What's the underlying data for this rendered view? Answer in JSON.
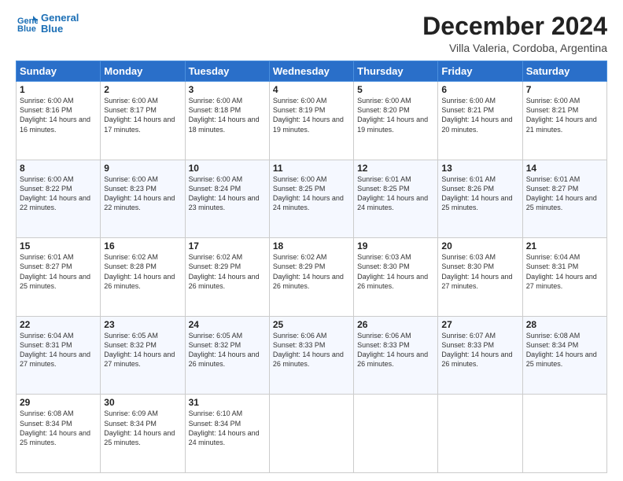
{
  "logo": {
    "text_general": "General",
    "text_blue": "Blue"
  },
  "header": {
    "title": "December 2024",
    "subtitle": "Villa Valeria, Cordoba, Argentina"
  },
  "days_of_week": [
    "Sunday",
    "Monday",
    "Tuesday",
    "Wednesday",
    "Thursday",
    "Friday",
    "Saturday"
  ],
  "weeks": [
    [
      {
        "day": "1",
        "sunrise": "Sunrise: 6:00 AM",
        "sunset": "Sunset: 8:16 PM",
        "daylight": "Daylight: 14 hours and 16 minutes."
      },
      {
        "day": "2",
        "sunrise": "Sunrise: 6:00 AM",
        "sunset": "Sunset: 8:17 PM",
        "daylight": "Daylight: 14 hours and 17 minutes."
      },
      {
        "day": "3",
        "sunrise": "Sunrise: 6:00 AM",
        "sunset": "Sunset: 8:18 PM",
        "daylight": "Daylight: 14 hours and 18 minutes."
      },
      {
        "day": "4",
        "sunrise": "Sunrise: 6:00 AM",
        "sunset": "Sunset: 8:19 PM",
        "daylight": "Daylight: 14 hours and 19 minutes."
      },
      {
        "day": "5",
        "sunrise": "Sunrise: 6:00 AM",
        "sunset": "Sunset: 8:20 PM",
        "daylight": "Daylight: 14 hours and 19 minutes."
      },
      {
        "day": "6",
        "sunrise": "Sunrise: 6:00 AM",
        "sunset": "Sunset: 8:21 PM",
        "daylight": "Daylight: 14 hours and 20 minutes."
      },
      {
        "day": "7",
        "sunrise": "Sunrise: 6:00 AM",
        "sunset": "Sunset: 8:21 PM",
        "daylight": "Daylight: 14 hours and 21 minutes."
      }
    ],
    [
      {
        "day": "8",
        "sunrise": "Sunrise: 6:00 AM",
        "sunset": "Sunset: 8:22 PM",
        "daylight": "Daylight: 14 hours and 22 minutes."
      },
      {
        "day": "9",
        "sunrise": "Sunrise: 6:00 AM",
        "sunset": "Sunset: 8:23 PM",
        "daylight": "Daylight: 14 hours and 22 minutes."
      },
      {
        "day": "10",
        "sunrise": "Sunrise: 6:00 AM",
        "sunset": "Sunset: 8:24 PM",
        "daylight": "Daylight: 14 hours and 23 minutes."
      },
      {
        "day": "11",
        "sunrise": "Sunrise: 6:00 AM",
        "sunset": "Sunset: 8:25 PM",
        "daylight": "Daylight: 14 hours and 24 minutes."
      },
      {
        "day": "12",
        "sunrise": "Sunrise: 6:01 AM",
        "sunset": "Sunset: 8:25 PM",
        "daylight": "Daylight: 14 hours and 24 minutes."
      },
      {
        "day": "13",
        "sunrise": "Sunrise: 6:01 AM",
        "sunset": "Sunset: 8:26 PM",
        "daylight": "Daylight: 14 hours and 25 minutes."
      },
      {
        "day": "14",
        "sunrise": "Sunrise: 6:01 AM",
        "sunset": "Sunset: 8:27 PM",
        "daylight": "Daylight: 14 hours and 25 minutes."
      }
    ],
    [
      {
        "day": "15",
        "sunrise": "Sunrise: 6:01 AM",
        "sunset": "Sunset: 8:27 PM",
        "daylight": "Daylight: 14 hours and 25 minutes."
      },
      {
        "day": "16",
        "sunrise": "Sunrise: 6:02 AM",
        "sunset": "Sunset: 8:28 PM",
        "daylight": "Daylight: 14 hours and 26 minutes."
      },
      {
        "day": "17",
        "sunrise": "Sunrise: 6:02 AM",
        "sunset": "Sunset: 8:29 PM",
        "daylight": "Daylight: 14 hours and 26 minutes."
      },
      {
        "day": "18",
        "sunrise": "Sunrise: 6:02 AM",
        "sunset": "Sunset: 8:29 PM",
        "daylight": "Daylight: 14 hours and 26 minutes."
      },
      {
        "day": "19",
        "sunrise": "Sunrise: 6:03 AM",
        "sunset": "Sunset: 8:30 PM",
        "daylight": "Daylight: 14 hours and 26 minutes."
      },
      {
        "day": "20",
        "sunrise": "Sunrise: 6:03 AM",
        "sunset": "Sunset: 8:30 PM",
        "daylight": "Daylight: 14 hours and 27 minutes."
      },
      {
        "day": "21",
        "sunrise": "Sunrise: 6:04 AM",
        "sunset": "Sunset: 8:31 PM",
        "daylight": "Daylight: 14 hours and 27 minutes."
      }
    ],
    [
      {
        "day": "22",
        "sunrise": "Sunrise: 6:04 AM",
        "sunset": "Sunset: 8:31 PM",
        "daylight": "Daylight: 14 hours and 27 minutes."
      },
      {
        "day": "23",
        "sunrise": "Sunrise: 6:05 AM",
        "sunset": "Sunset: 8:32 PM",
        "daylight": "Daylight: 14 hours and 27 minutes."
      },
      {
        "day": "24",
        "sunrise": "Sunrise: 6:05 AM",
        "sunset": "Sunset: 8:32 PM",
        "daylight": "Daylight: 14 hours and 26 minutes."
      },
      {
        "day": "25",
        "sunrise": "Sunrise: 6:06 AM",
        "sunset": "Sunset: 8:33 PM",
        "daylight": "Daylight: 14 hours and 26 minutes."
      },
      {
        "day": "26",
        "sunrise": "Sunrise: 6:06 AM",
        "sunset": "Sunset: 8:33 PM",
        "daylight": "Daylight: 14 hours and 26 minutes."
      },
      {
        "day": "27",
        "sunrise": "Sunrise: 6:07 AM",
        "sunset": "Sunset: 8:33 PM",
        "daylight": "Daylight: 14 hours and 26 minutes."
      },
      {
        "day": "28",
        "sunrise": "Sunrise: 6:08 AM",
        "sunset": "Sunset: 8:34 PM",
        "daylight": "Daylight: 14 hours and 25 minutes."
      }
    ],
    [
      {
        "day": "29",
        "sunrise": "Sunrise: 6:08 AM",
        "sunset": "Sunset: 8:34 PM",
        "daylight": "Daylight: 14 hours and 25 minutes."
      },
      {
        "day": "30",
        "sunrise": "Sunrise: 6:09 AM",
        "sunset": "Sunset: 8:34 PM",
        "daylight": "Daylight: 14 hours and 25 minutes."
      },
      {
        "day": "31",
        "sunrise": "Sunrise: 6:10 AM",
        "sunset": "Sunset: 8:34 PM",
        "daylight": "Daylight: 14 hours and 24 minutes."
      },
      null,
      null,
      null,
      null
    ]
  ]
}
